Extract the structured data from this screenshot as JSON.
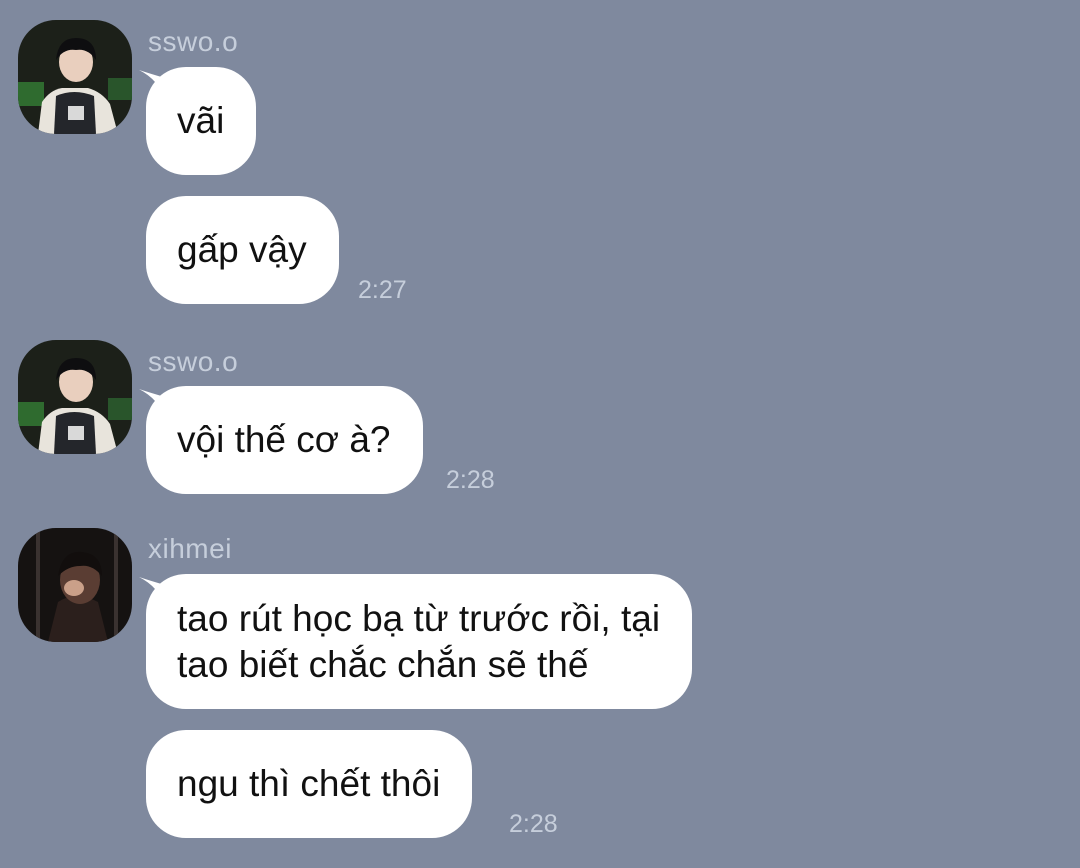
{
  "messages": [
    {
      "sender": "sswo.o",
      "avatar": "user-photo-sswo",
      "bubbles": [
        {
          "text": "vãi"
        },
        {
          "text": "gấp vậy",
          "time": "2:27"
        }
      ]
    },
    {
      "sender": "sswo.o",
      "avatar": "user-photo-sswo",
      "bubbles": [
        {
          "text": "vội thế cơ à?",
          "time": "2:28"
        }
      ]
    },
    {
      "sender": "xihmei",
      "avatar": "user-photo-xihmei",
      "bubbles": [
        {
          "lines": [
            "tao rút học bạ từ trước rồi, tại",
            "tao biết chắc chắn sẽ thế"
          ]
        },
        {
          "text": "ngu thì chết thôi",
          "time": "2:28"
        }
      ]
    }
  ],
  "colors": {
    "background": "#7f899e",
    "bubble": "#ffffff",
    "meta_text": "#c6cedb",
    "message_text": "#111111"
  }
}
